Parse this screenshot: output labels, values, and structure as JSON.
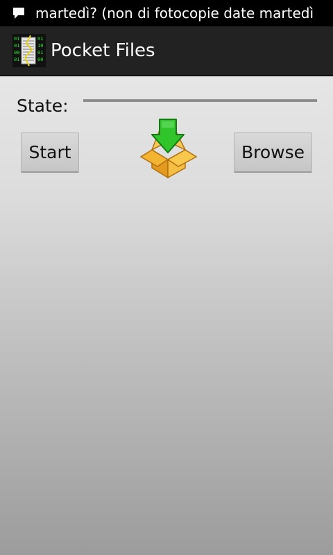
{
  "status_bar": {
    "notification_icon": "chat-bubble-icon",
    "ticker_text": "martedì? (non di fotocopie date martedì"
  },
  "action_bar": {
    "app_icon": "pocket-files-app-icon",
    "title": "Pocket Files"
  },
  "main": {
    "state_label": "State:",
    "progress": 0,
    "start_button": "Start",
    "browse_button": "Browse",
    "center_icon": "download-box-icon"
  },
  "colors": {
    "action_bar_bg": "#222222",
    "status_bar_bg": "#000000",
    "box_orange": "#f3b431",
    "arrow_green": "#2fc52b"
  }
}
